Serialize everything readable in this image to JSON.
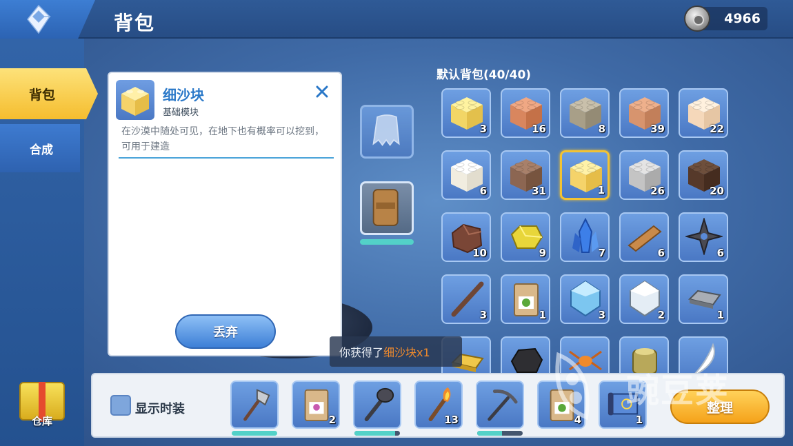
{
  "header": {
    "title": "背包",
    "currency_value": "4966"
  },
  "sidebar": {
    "tabs": [
      {
        "label": "背包"
      },
      {
        "label": "合成"
      }
    ],
    "warehouse_label": "仓库"
  },
  "detail": {
    "name": "细沙块",
    "category": "基础模块",
    "description": "在沙漠中随处可见，在地下也有概率可以挖到，可用于建造",
    "discard_label": "丢弃"
  },
  "inventory": {
    "title": "默认背包(40/40)",
    "slots": [
      {
        "icon": "yellow-sand-block-icon",
        "count": "3"
      },
      {
        "icon": "terracotta-block-icon",
        "count": "16"
      },
      {
        "icon": "gray-stone-block-icon",
        "count": "8"
      },
      {
        "icon": "clay-block-icon",
        "count": "39"
      },
      {
        "icon": "light-sand-block-icon",
        "count": "22"
      },
      {
        "icon": "white-block-icon",
        "count": "6"
      },
      {
        "icon": "brown-wood-block-icon",
        "count": "31"
      },
      {
        "icon": "fine-sand-block-icon",
        "count": "1",
        "selected": true
      },
      {
        "icon": "silver-stone-block-icon",
        "count": "26"
      },
      {
        "icon": "dark-wood-block-icon",
        "count": "20"
      },
      {
        "icon": "brown-ore-icon",
        "count": "10"
      },
      {
        "icon": "gold-ore-icon",
        "count": "9"
      },
      {
        "icon": "blue-crystal-icon",
        "count": "7"
      },
      {
        "icon": "wood-plank-icon",
        "count": "6"
      },
      {
        "icon": "shuriken-icon",
        "count": "6"
      },
      {
        "icon": "wooden-stick-icon",
        "count": "3"
      },
      {
        "icon": "seed-bag-icon",
        "count": "1"
      },
      {
        "icon": "blue-gem-icon",
        "count": "3"
      },
      {
        "icon": "clear-gem-icon",
        "count": "2"
      },
      {
        "icon": "iron-ingot-icon",
        "count": "1"
      },
      {
        "icon": "gold-bar-icon",
        "count": ""
      },
      {
        "icon": "coal-icon",
        "count": ""
      },
      {
        "icon": "orange-spider-icon",
        "count": ""
      },
      {
        "icon": "brass-cylinder-icon",
        "count": ""
      },
      {
        "icon": "white-fang-icon",
        "count": ""
      }
    ]
  },
  "toast": {
    "prefix": "你获得了",
    "item": "细沙块x1"
  },
  "hotbar": {
    "show_costume_label": "显示时装",
    "sort_label": "整理",
    "slots": [
      {
        "icon": "stone-axe-icon",
        "count": "",
        "durability": 1.0
      },
      {
        "icon": "flower-seed-bag-icon",
        "count": "2"
      },
      {
        "icon": "stone-club-icon",
        "count": "",
        "durability": 0.9
      },
      {
        "icon": "torch-icon",
        "count": "13"
      },
      {
        "icon": "pickaxe-icon",
        "count": "",
        "durability": 0.55
      },
      {
        "icon": "seed-bag-icon",
        "count": "4"
      },
      {
        "icon": "blueprint-scroll-icon",
        "count": "1"
      }
    ]
  },
  "watermark": "豌豆荚",
  "colors": {
    "accent_yellow": "#f5bd2e",
    "panel_blue": "#4a78c4",
    "highlight_orange": "#f08a2c",
    "durability_cyan": "#53d1c8"
  }
}
